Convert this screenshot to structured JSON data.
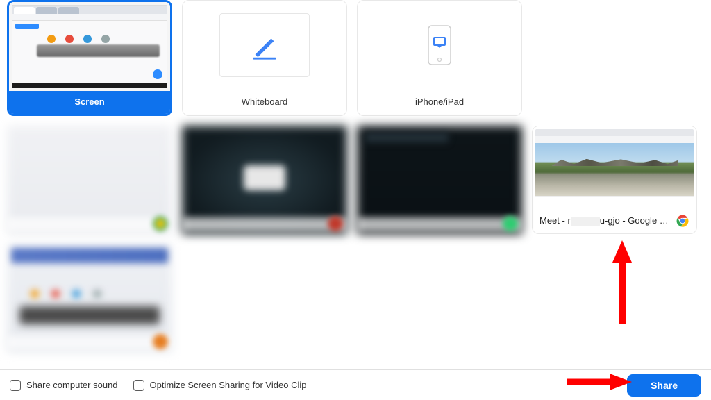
{
  "options": {
    "screen": {
      "label": "Screen"
    },
    "whiteboard": {
      "label": "Whiteboard"
    },
    "iphone_ipad": {
      "label": "iPhone/iPad"
    }
  },
  "windows": {
    "meet": {
      "label_prefix": "Meet - r",
      "label_suffix": "u-gjo - Google C...",
      "app": "Google Chrome"
    }
  },
  "footer": {
    "share_sound_label": "Share computer sound",
    "optimize_label": "Optimize Screen Sharing for Video Clip",
    "share_button": "Share"
  },
  "colors": {
    "accent": "#0e72ed",
    "arrow": "#ff0000"
  }
}
